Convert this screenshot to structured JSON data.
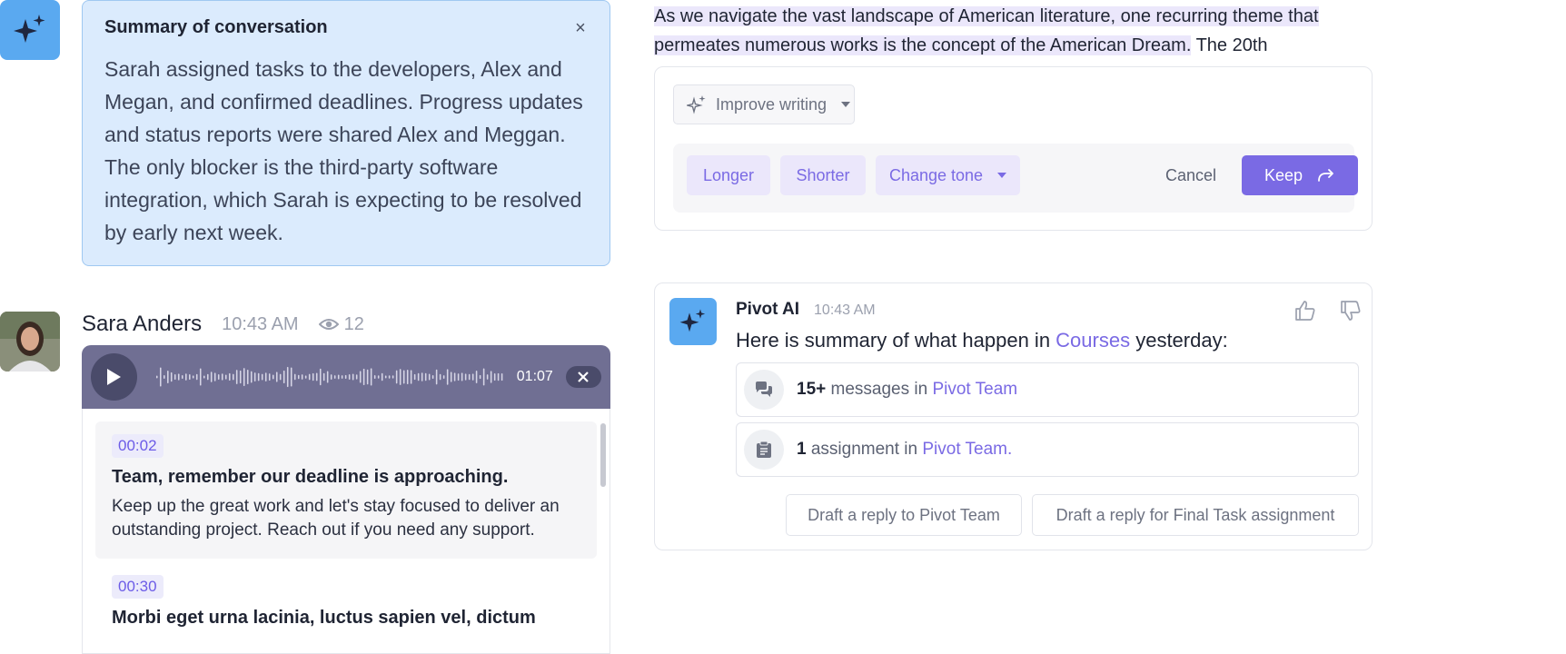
{
  "summary": {
    "title": "Summary of conversation",
    "close": "×",
    "text": "Sarah assigned tasks to the developers, Alex and Megan, and confirmed deadlines. Progress updates and status reports were shared Alex and Meggan. The only blocker is the third-party software integration, which Sarah is expecting to be resolved by early next week."
  },
  "message": {
    "author": "Sara Anders",
    "time": "10:43 AM",
    "views": "12",
    "audio": {
      "duration": "01:07"
    },
    "transcript": [
      {
        "stamp": "00:02",
        "title": "Team, remember our deadline is approaching.",
        "body": "Keep up the great work and let's stay focused to deliver an outstanding project. Reach out if you need any support."
      },
      {
        "stamp": "00:30",
        "title": "Morbi eget urna lacinia, luctus sapien vel, dictum",
        "body": ""
      }
    ]
  },
  "editor": {
    "highlighted": "As we navigate the vast landscape of American literature, one recurring theme that permeates numerous works is the concept of the American Dream.",
    "rest": " The 20th",
    "improve_label": "Improve writing",
    "chips": {
      "longer": "Longer",
      "shorter": "Shorter",
      "change_tone": "Change tone"
    },
    "cancel": "Cancel",
    "keep": "Keep"
  },
  "ai_card": {
    "name": "Pivot AI",
    "time": "10:43 AM",
    "text_before": "Here is summary of what happen in ",
    "text_link": "Courses",
    "text_after": " yesterday:",
    "rows": [
      {
        "count": "15+",
        "label": " messages in ",
        "link": "Pivot Team"
      },
      {
        "count": "1",
        "label": " assignment in ",
        "link": "Pivot Team."
      }
    ],
    "drafts": [
      "Draft a reply to Pivot Team",
      "Draft a reply for Final Task assignment"
    ]
  },
  "colors": {
    "accent": "#7a6ae4",
    "ai_blue": "#5aa9f0",
    "summary_bg": "#dbebfd",
    "player_bg": "#706f93"
  }
}
